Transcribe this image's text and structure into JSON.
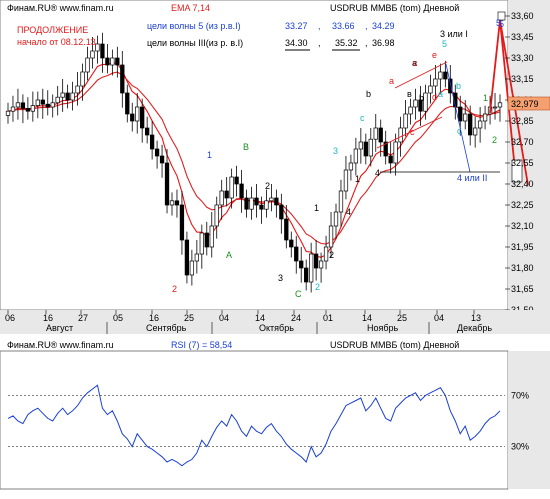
{
  "chart_data": [
    {
      "type": "candlestick",
      "source": "Финам.RU® www.finam.ru",
      "instrument": "USDRUB ММВБ (tom) Дневной",
      "indicator": "EMA 7,14",
      "note_line1": "ПРОДОЛЖЕНИЕ",
      "note_line2": "начало  от  08.12.13",
      "wave_table": {
        "row1_label": "цели волны 5 (из р.в.I)",
        "row1_values": [
          "33.27",
          "33.66",
          "34.29"
        ],
        "row2_label": "цели волны III(из р. в.I)",
        "row2_values": [
          "34.30",
          "35.32",
          "36.98"
        ],
        "separator": ","
      },
      "last_price": "32,979",
      "ylim": [
        31.5,
        33.6
      ],
      "y_ticks": [
        "33,60",
        "33,45",
        "33,30",
        "33,15",
        "33,00",
        "32,85",
        "32,70",
        "32,55",
        "32,40",
        "32,25",
        "32,10",
        "31,95",
        "31,80",
        "31,65",
        "31,50"
      ],
      "x_day_ticks": [
        "06",
        "16",
        "27",
        "05",
        "16",
        "25",
        "04",
        "14",
        "24",
        "01",
        "14",
        "25",
        "04",
        "13"
      ],
      "x_month_labels": [
        "Август",
        "Сентябрь",
        "Октябрь",
        "Ноябрь",
        "Декабрь"
      ],
      "wave_labels": [
        "1",
        "B",
        "A",
        "2",
        "1",
        "2",
        "3",
        "4",
        "C",
        "2",
        "1",
        "2",
        "3",
        "4",
        "a",
        "b",
        "c",
        "d",
        "e",
        "5",
        "в",
        "a",
        "b",
        "c",
        "c",
        "3 или I",
        "5",
        "a",
        "b",
        "c",
        "4 или II",
        "1",
        "2",
        "5"
      ],
      "closes": [
        32.92,
        32.95,
        32.98,
        32.94,
        32.92,
        32.96,
        33.0,
        32.97,
        32.95,
        32.98,
        33.02,
        33.05,
        33.0,
        33.05,
        33.1,
        33.2,
        33.3,
        33.35,
        33.4,
        33.3,
        33.25,
        33.3,
        33.25,
        33.05,
        32.9,
        32.85,
        32.95,
        32.8,
        32.75,
        32.65,
        32.6,
        32.55,
        32.25,
        32.28,
        32.25,
        32.0,
        31.75,
        31.85,
        31.9,
        32.05,
        31.95,
        32.1,
        32.25,
        32.35,
        32.3,
        32.45,
        32.4,
        32.3,
        32.22,
        32.3,
        32.25,
        32.22,
        32.28,
        32.3,
        32.25,
        32.15,
        32.0,
        31.95,
        31.85,
        31.8,
        31.7,
        31.9,
        31.8,
        31.85,
        31.95,
        32.1,
        32.2,
        32.35,
        32.5,
        32.55,
        32.65,
        32.7,
        32.6,
        32.72,
        32.8,
        32.7,
        32.6,
        32.55,
        32.7,
        32.8,
        32.9,
        32.95,
        33.0,
        32.92,
        33.05,
        33.1,
        33.15,
        33.2,
        33.15,
        33.05,
        32.95,
        32.85,
        32.9,
        32.75,
        32.8,
        32.85,
        32.9,
        32.95,
        32.95,
        32.98
      ]
    },
    {
      "type": "line",
      "source": "Финам.RU® www.finam.ru",
      "instrument": "USDRUB ММВБ (tom) Дневной",
      "indicator": "RSI (7) = 58,54",
      "ylim": [
        0,
        100
      ],
      "levels": [
        70,
        30
      ],
      "level_labels": [
        "70%",
        "30%"
      ],
      "values": [
        52,
        54,
        50,
        48,
        55,
        58,
        60,
        56,
        52,
        50,
        56,
        60,
        55,
        58,
        62,
        68,
        72,
        75,
        78,
        60,
        55,
        58,
        50,
        40,
        36,
        30,
        40,
        35,
        30,
        28,
        25,
        22,
        18,
        20,
        18,
        15,
        18,
        20,
        25,
        35,
        30,
        38,
        45,
        50,
        46,
        55,
        50,
        42,
        38,
        46,
        42,
        40,
        45,
        48,
        42,
        38,
        32,
        28,
        25,
        22,
        18,
        30,
        22,
        25,
        32,
        42,
        48,
        55,
        62,
        64,
        66,
        68,
        58,
        62,
        68,
        60,
        52,
        50,
        60,
        64,
        68,
        70,
        72,
        66,
        70,
        72,
        74,
        76,
        70,
        58,
        50,
        40,
        46,
        35,
        38,
        42,
        48,
        52,
        54,
        58
      ]
    }
  ],
  "colors": {
    "ema_fast": "#ee1111",
    "ema_slow": "#dd2222",
    "rsi": "#1a3fd6",
    "wave_red": "#e41b1b",
    "wave_blue": "#1a3fd6",
    "wave_green": "#1c8f1c",
    "wave_cyan": "#19b7c6",
    "price_box": "#f5a070",
    "axis_bg": "#e8e8e8"
  }
}
